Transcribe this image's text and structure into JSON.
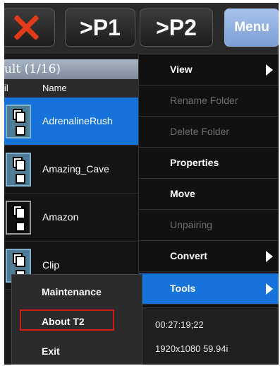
{
  "toolbar": {
    "close_icon": "close-x-icon",
    "close_color": "#e33a1a",
    "p1_label": ">P1",
    "p2_label": ">P2",
    "menu_label": "Menu",
    "menu_color": "#8eaee0"
  },
  "list": {
    "title": "ult (1/16)",
    "col_left": "il",
    "col_name": "Name",
    "rows": [
      {
        "name": "AdrenalineRush",
        "selected": true
      },
      {
        "name": "Amazing_Cave",
        "selected": false
      },
      {
        "name": "Amazon",
        "selected": false
      },
      {
        "name": "Clip",
        "selected": false
      }
    ]
  },
  "menu": {
    "items": [
      {
        "label": "View",
        "submenu": true,
        "enabled": true
      },
      {
        "label": "Rename Folder",
        "submenu": false,
        "enabled": false
      },
      {
        "label": "Delete Folder",
        "submenu": false,
        "enabled": false
      },
      {
        "label": "Properties",
        "submenu": false,
        "enabled": true
      },
      {
        "label": "Move",
        "submenu": false,
        "enabled": true
      },
      {
        "label": "Unpairing",
        "submenu": false,
        "enabled": false
      },
      {
        "label": "Convert",
        "submenu": true,
        "enabled": true
      },
      {
        "label": "Tools",
        "submenu": true,
        "enabled": true,
        "active": true
      }
    ]
  },
  "submenu": {
    "items": [
      "Maintenance",
      "About T2",
      "Exit"
    ]
  },
  "info": {
    "timecode": "00:27:19;22",
    "format": "1920x1080 59.94i"
  },
  "accent_color": "#1673d9",
  "highlight_color": "#d01a1a"
}
